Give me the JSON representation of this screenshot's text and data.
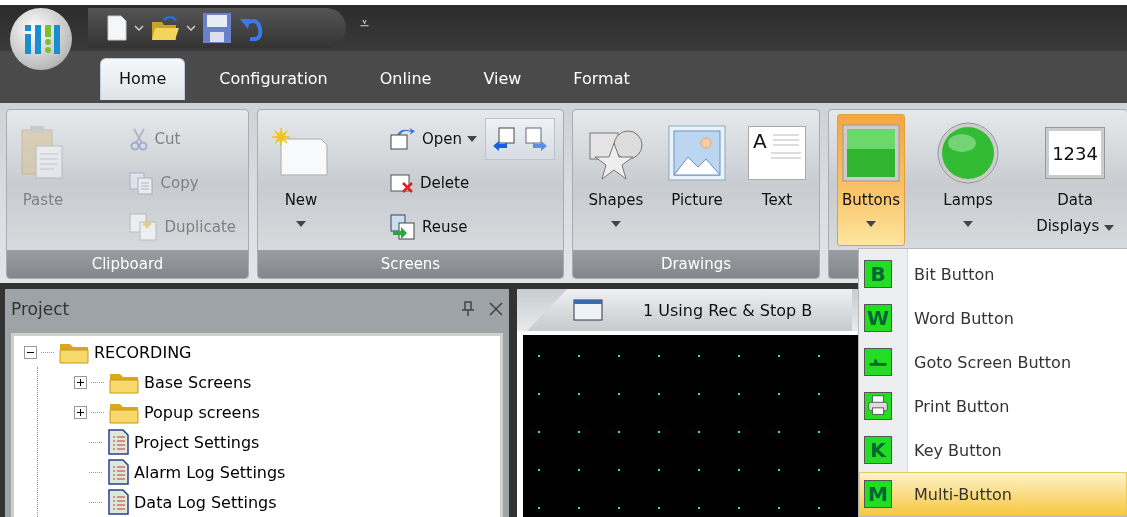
{
  "quick_access": {
    "overflow_glyph": "⩡"
  },
  "tabs": [
    {
      "label": "Home",
      "selected": true
    },
    {
      "label": "Configuration",
      "selected": false
    },
    {
      "label": "Online",
      "selected": false
    },
    {
      "label": "View",
      "selected": false
    },
    {
      "label": "Format",
      "selected": false
    }
  ],
  "ribbon_groups": [
    {
      "title": "Clipboard",
      "items": [
        {
          "kind": "large",
          "label": "Paste",
          "disabled": true,
          "dropdown": false,
          "pressed": false
        },
        {
          "kind": "small",
          "label": "Cut",
          "disabled": true,
          "dropdown": false,
          "pressed": false
        },
        {
          "kind": "small",
          "label": "Copy",
          "disabled": true,
          "dropdown": false,
          "pressed": false
        },
        {
          "kind": "small",
          "label": "Duplicate",
          "disabled": true,
          "dropdown": false,
          "pressed": false
        }
      ]
    },
    {
      "title": "Screens",
      "items": [
        {
          "kind": "large",
          "label": "New",
          "disabled": false,
          "dropdown": true,
          "pressed": false
        },
        {
          "kind": "small",
          "label": "Open",
          "disabled": false,
          "dropdown": true,
          "pressed": false
        },
        {
          "kind": "icon",
          "disabled": false,
          "pressed": false
        },
        {
          "kind": "icon",
          "disabled": false,
          "pressed": false
        },
        {
          "kind": "small",
          "label": "Delete",
          "disabled": false,
          "dropdown": false,
          "pressed": false
        },
        {
          "kind": "small",
          "label": "Reuse",
          "disabled": false,
          "dropdown": false,
          "pressed": false
        }
      ]
    },
    {
      "title": "Drawings",
      "items": [
        {
          "kind": "large",
          "label": "Shapes",
          "disabled": false,
          "dropdown": true,
          "pressed": false
        },
        {
          "kind": "large",
          "label": "Picture",
          "disabled": false,
          "dropdown": false,
          "pressed": false
        },
        {
          "kind": "large",
          "label": "Text",
          "icon_text": "A",
          "disabled": false,
          "dropdown": false,
          "pressed": false
        }
      ]
    },
    {
      "items": [
        {
          "kind": "large",
          "label": "Buttons",
          "disabled": false,
          "dropdown": true,
          "pressed": true
        },
        {
          "kind": "large",
          "label": "Lamps",
          "disabled": false,
          "dropdown": true,
          "pressed": false
        },
        {
          "kind": "large",
          "label": "Data Displays",
          "icon_text": "1234",
          "disabled": false,
          "dropdown": true,
          "pressed": false
        }
      ]
    }
  ],
  "project_panel": {
    "title": "Project",
    "tree": [
      {
        "label": "RECORDING",
        "kind": "folder",
        "expanded": true,
        "children": [
          {
            "label": "Base Screens",
            "kind": "folder",
            "expanded": false
          },
          {
            "label": "Popup screens",
            "kind": "folder",
            "expanded": false
          },
          {
            "label": "Project Settings",
            "kind": "settings"
          },
          {
            "label": "Alarm Log Settings",
            "kind": "settings"
          },
          {
            "label": "Data Log Settings",
            "kind": "settings"
          }
        ]
      }
    ]
  },
  "document": {
    "tab_title": "1 Using Rec & Stop B"
  },
  "buttons_menu": [
    {
      "kind": "letter",
      "glyph": "B",
      "label": "Bit Button",
      "selected": false
    },
    {
      "kind": "letter",
      "glyph": "W",
      "label": "Word Button",
      "selected": false
    },
    {
      "kind": "goto",
      "label": "Goto Screen Button",
      "selected": false
    },
    {
      "kind": "print",
      "label": "Print Button",
      "selected": false
    },
    {
      "kind": "letter",
      "glyph": "K",
      "label": "Key Button",
      "selected": false
    },
    {
      "kind": "letter",
      "glyph": "M",
      "label": "Multi-Button",
      "selected": true
    }
  ]
}
